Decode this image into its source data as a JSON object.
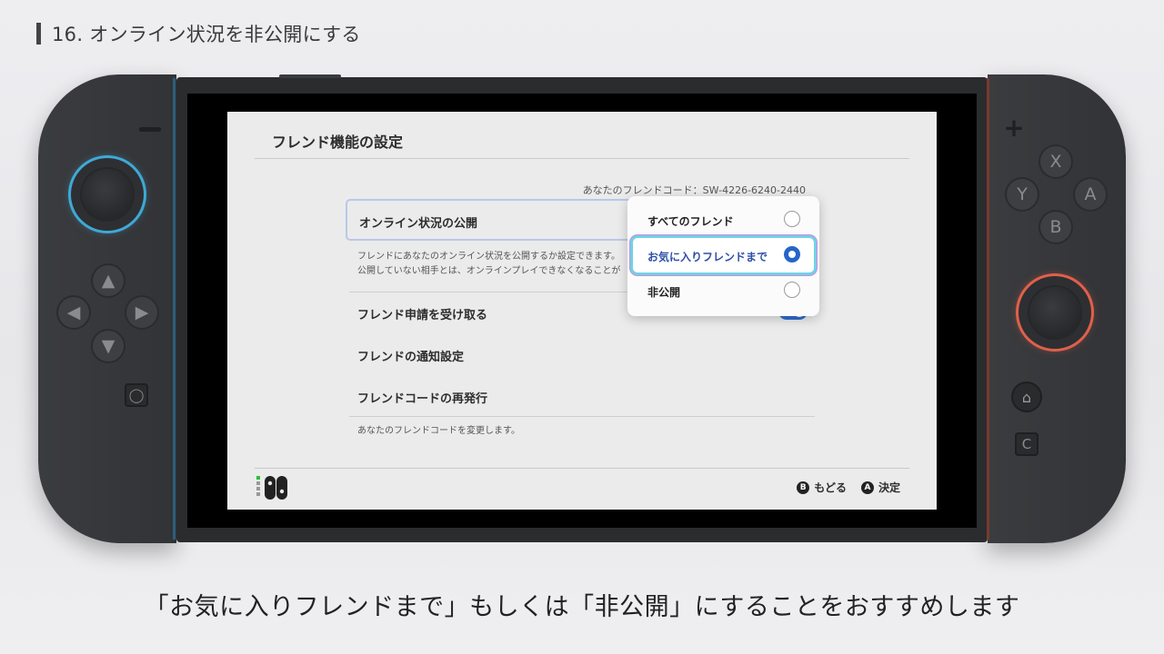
{
  "slide": {
    "title": "16. オンライン状況を非公開にする",
    "caption": "「お気に入りフレンドまで」もしくは「非公開」にすることをおすすめします"
  },
  "console": {
    "buttons": {
      "x": "X",
      "y": "Y",
      "a": "A",
      "b": "B",
      "capture": "C"
    },
    "left_stick_color": "#3fa9d6",
    "right_stick_color": "#e0604a"
  },
  "screen": {
    "header": "フレンド機能の設定",
    "friend_code": "あなたのフレンドコード：SW-4226-6240-2440",
    "online_status": {
      "label": "オンライン状況の公開",
      "desc_line1": "フレンドにあなたのオンライン状況を公開するか設定できます。",
      "desc_line2": "公開していない相手とは、オンラインプレイできなくなることが"
    },
    "rows": [
      {
        "label": "フレンド申請を受け取る"
      },
      {
        "label": "フレンドの通知設定"
      },
      {
        "label": "フレンドコードの再発行"
      }
    ],
    "reissue_desc": "あなたのフレンドコードを変更します。",
    "popup": {
      "options": [
        {
          "label": "すべてのフレンド",
          "selected": false
        },
        {
          "label": "お気に入りフレンドまで",
          "selected": true
        },
        {
          "label": "非公開",
          "selected": false
        }
      ]
    },
    "footer": {
      "back_glyph": "B",
      "back_label": "もどる",
      "ok_glyph": "A",
      "ok_label": "決定"
    },
    "accent_color": "#2565c8"
  }
}
